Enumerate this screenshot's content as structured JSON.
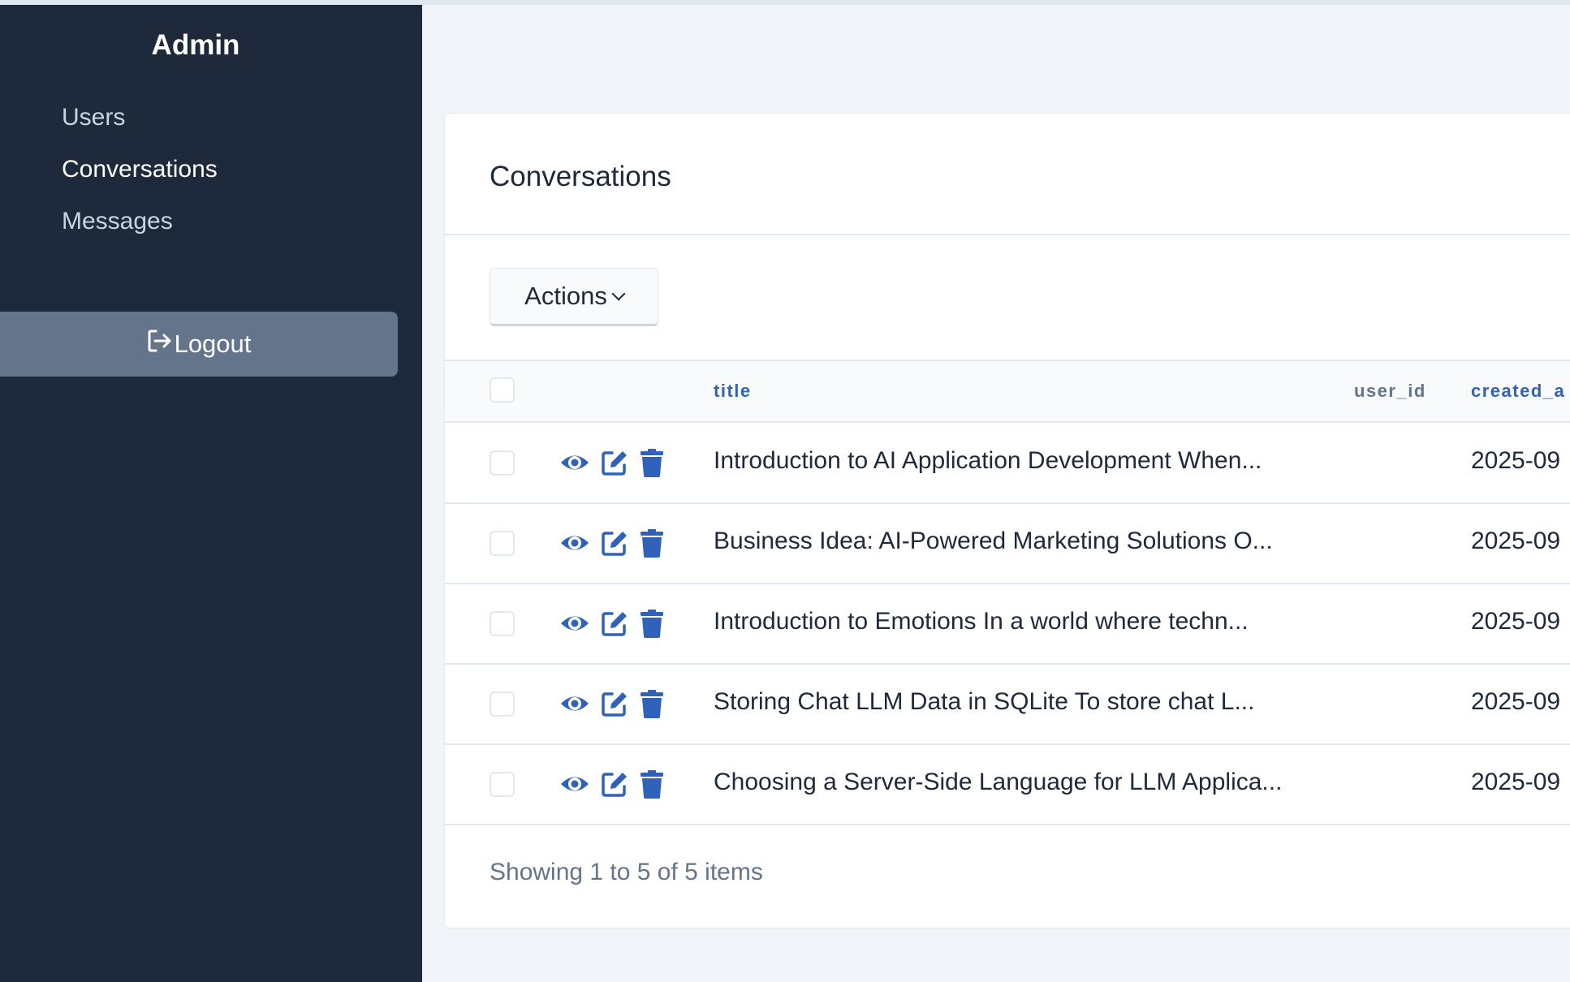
{
  "sidebar": {
    "brand": "Admin",
    "items": [
      {
        "label": "Users",
        "active": false
      },
      {
        "label": "Conversations",
        "active": true
      },
      {
        "label": "Messages",
        "active": false
      }
    ],
    "logout_label": "Logout",
    "logout_icon": "logout-icon"
  },
  "card": {
    "title": "Conversations",
    "actions_label": "Actions",
    "columns": {
      "title": "title",
      "user_id": "user_id",
      "created_at": "created_a"
    },
    "row_icons": [
      "eye-icon",
      "edit-icon",
      "trash-icon"
    ],
    "rows": [
      {
        "title": "Introduction to AI Application Development When...",
        "created_at": "2025-09"
      },
      {
        "title": "Business Idea: AI-Powered Marketing Solutions O...",
        "created_at": "2025-09"
      },
      {
        "title": "Introduction to Emotions In a world where techn...",
        "created_at": "2025-09"
      },
      {
        "title": "Storing Chat LLM Data in SQLite To store chat L...",
        "created_at": "2025-09"
      },
      {
        "title": "Choosing a Server-Side Language for LLM Applica...",
        "created_at": "2025-09"
      }
    ],
    "footer": "Showing 1 to 5 of 5 items"
  },
  "colors": {
    "sidebar_bg": "#1e293b",
    "accent": "#2f62b8",
    "logout_bg": "#64748b",
    "page_bg": "#f1f5f9"
  }
}
